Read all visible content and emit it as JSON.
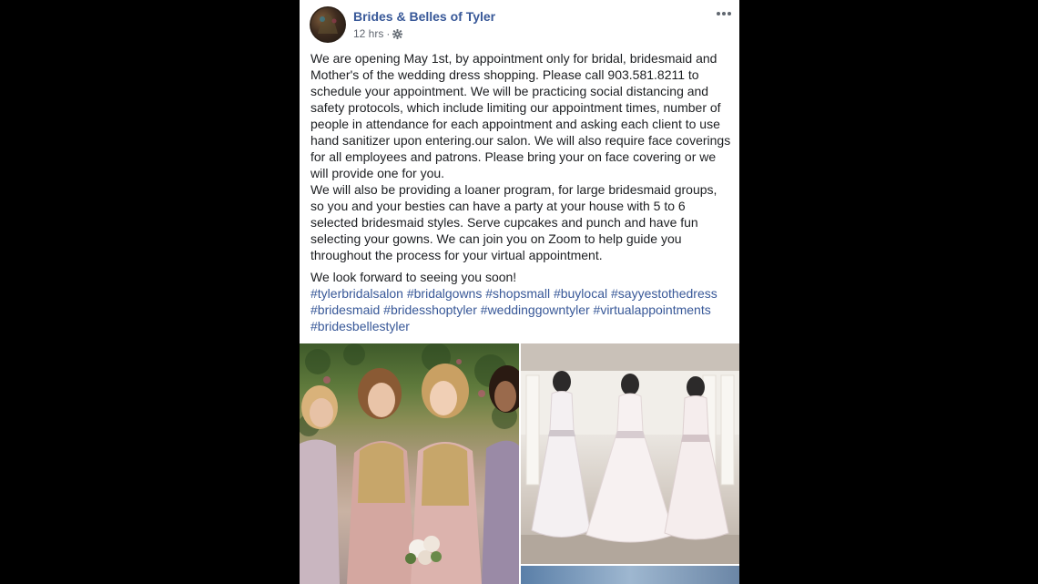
{
  "post": {
    "page_name": "Brides & Belles of Tyler",
    "time": "12 hrs",
    "dot": "·",
    "paragraphs": [
      "We are opening May 1st, by appointment only for bridal, bridesmaid and Mother's of the wedding dress shopping. Please call 903.581.8211 to schedule your appointment. We will be practicing social distancing and safety protocols, which include limiting our appointment times, number of people in attendance for each appointment and asking each client to use hand sanitizer upon entering.our salon. We will also require face coverings for all employees and patrons. Please bring your on face covering or we will provide one for you.",
      "We will also be providing a loaner program, for large bridesmaid groups, so you and your besties can have a party at your house with 5 to 6 selected bridesmaid styles. Serve cupcakes and punch and have fun selecting your gowns. We can join you on Zoom to help guide you throughout the process for your virtual appointment.",
      "We look forward to seeing you soon!"
    ],
    "hashtags": [
      "#tylerbridalsalon",
      "#bridalgowns",
      "#shopsmall",
      "#buylocal",
      "#sayyestothedress",
      "#bridesmaid",
      "#bridesshoptyler",
      "#weddinggowntyler",
      "#virtualappointments",
      "#bridesbellestyler"
    ],
    "colors": {
      "link": "#385898",
      "text": "#1c1e21",
      "meta": "#616770"
    },
    "icons": {
      "audience": "gear-icon",
      "more": "more-options-icon"
    }
  }
}
